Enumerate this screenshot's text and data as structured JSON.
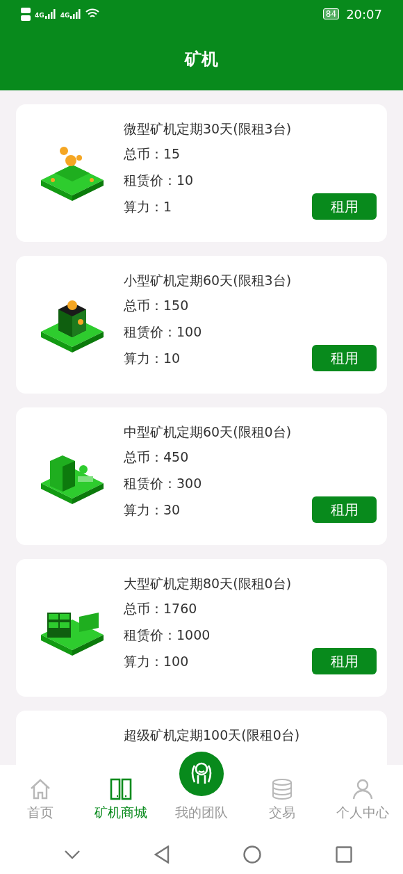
{
  "status_bar": {
    "networks": [
      "4G",
      "4G"
    ],
    "battery": "84",
    "time": "20:07"
  },
  "header": {
    "title": "矿机"
  },
  "machines": [
    {
      "kind": "platform",
      "title": "微型矿机定期30天(限租3台)",
      "total": "总币：15",
      "price": "租赁价：10",
      "power": "算力：1",
      "button": "租用"
    },
    {
      "kind": "cube",
      "title": "小型矿机定期60天(限租3台)",
      "total": "总币：150",
      "price": "租赁价：100",
      "power": "算力：10",
      "button": "租用"
    },
    {
      "kind": "building",
      "title": "中型矿机定期60天(限租0台)",
      "total": "总币：450",
      "price": "租赁价：300",
      "power": "算力：30",
      "button": "租用"
    },
    {
      "kind": "racks",
      "title": "大型矿机定期80天(限租0台)",
      "total": "总币：1760",
      "price": "租赁价：1000",
      "power": "算力：100",
      "button": "租用"
    },
    {
      "title": "超级矿机定期100天(限租0台)"
    }
  ],
  "tabs": [
    {
      "kind": "home",
      "label": "首页",
      "selected": false
    },
    {
      "kind": "shop",
      "label": "矿机商城",
      "selected": true
    },
    {
      "kind": "center",
      "label": "我的团队",
      "selected": false
    },
    {
      "kind": "coins",
      "label": "交易",
      "selected": false
    },
    {
      "kind": "person",
      "label": "个人中心",
      "selected": false
    }
  ]
}
